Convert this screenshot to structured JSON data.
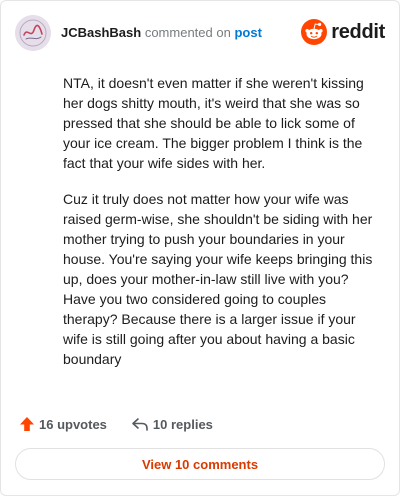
{
  "header": {
    "username": "JCBashBash",
    "commented_text": "commented on",
    "post_link": "post",
    "brand": "reddit"
  },
  "comment": {
    "paragraphs": [
      "NTA, it doesn't even matter if she weren't kissing her dogs shitty mouth, it's weird that she was so pressed that she should be able to lick some of your ice cream. The bigger problem I think is the fact that your wife sides with her.",
      "Cuz it truly does not matter how your wife was raised germ-wise, she shouldn't be siding with her mother trying to push your boundaries in your house. You're saying your wife keeps bringing this up, does your mother-in-law still live with you? Have you two considered going to couples therapy? Because there is a larger issue if your wife is still going after you about having a basic boundary"
    ]
  },
  "actions": {
    "upvotes": "16 upvotes",
    "replies": "10 replies"
  },
  "footer": {
    "view_comments": "View 10 comments"
  },
  "colors": {
    "brand_orange": "#ff4500",
    "upvote_orange": "#ff4500",
    "link_blue": "#0079d3",
    "view_button_text": "#d93a00"
  },
  "icons": {
    "avatar": "avatar-icon",
    "brand": "reddit-logo-icon",
    "upvote": "upvote-arrow-icon",
    "reply": "reply-arrow-icon"
  }
}
